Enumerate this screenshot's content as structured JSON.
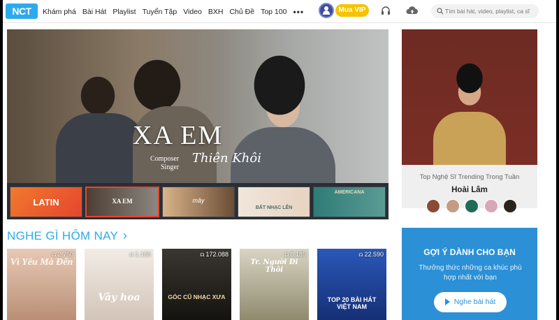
{
  "header": {
    "logo": "NCT",
    "nav": [
      "Khám phá",
      "Bài Hát",
      "Playlist",
      "Tuyển Tập",
      "Video",
      "BXH",
      "Chủ Đề",
      "Top 100"
    ],
    "more": "•••",
    "vip_label": "Mua VIP",
    "search_placeholder": "Tìm bài hát, video, playlist, ca sĩ"
  },
  "banner": {
    "title": "XA EM",
    "credit_lines": [
      "Composer",
      "Singer"
    ],
    "signature": "Thiên Khôi",
    "thumbnails": [
      "LATIN",
      "XA EM",
      "mây",
      "BẤT NHẠC LÊN",
      "AMERICANA"
    ]
  },
  "trending": {
    "caption": "Top Nghệ Sĩ Trending Trong Tuần",
    "artist": "Hoài Lâm",
    "avatar_colors": [
      "#8a4b35",
      "#c49c83",
      "#1f6b56",
      "#d9a6b8",
      "#2a2420"
    ]
  },
  "section": {
    "title": "NGHE GÌ HÔM NAY",
    "chevron": "›"
  },
  "cards": [
    {
      "count": "2.750",
      "text": "Vì Yêu Mà Đến",
      "bg": "#d7b6a1"
    },
    {
      "count": "1.155",
      "text": "Vây hoa",
      "bg": "#e6ddd6"
    },
    {
      "count": "172.088",
      "text": "GÓC CŨ NHẠC XƯA",
      "bg": "#2a2722"
    },
    {
      "count": "8.185",
      "text": "Tr. Người Đi Thôi",
      "bg": "#b9ad92"
    },
    {
      "count": "22.590",
      "text": "TOP 20 BÀI HÁT VIỆT NAM",
      "bg": "#1b3a8a"
    }
  ],
  "recommend": {
    "title": "GỢI Ý DÀNH CHO BẠN",
    "description": "Thưởng thức những ca khúc phù hợp nhất với bạn",
    "button": "Nghe bài hát"
  }
}
